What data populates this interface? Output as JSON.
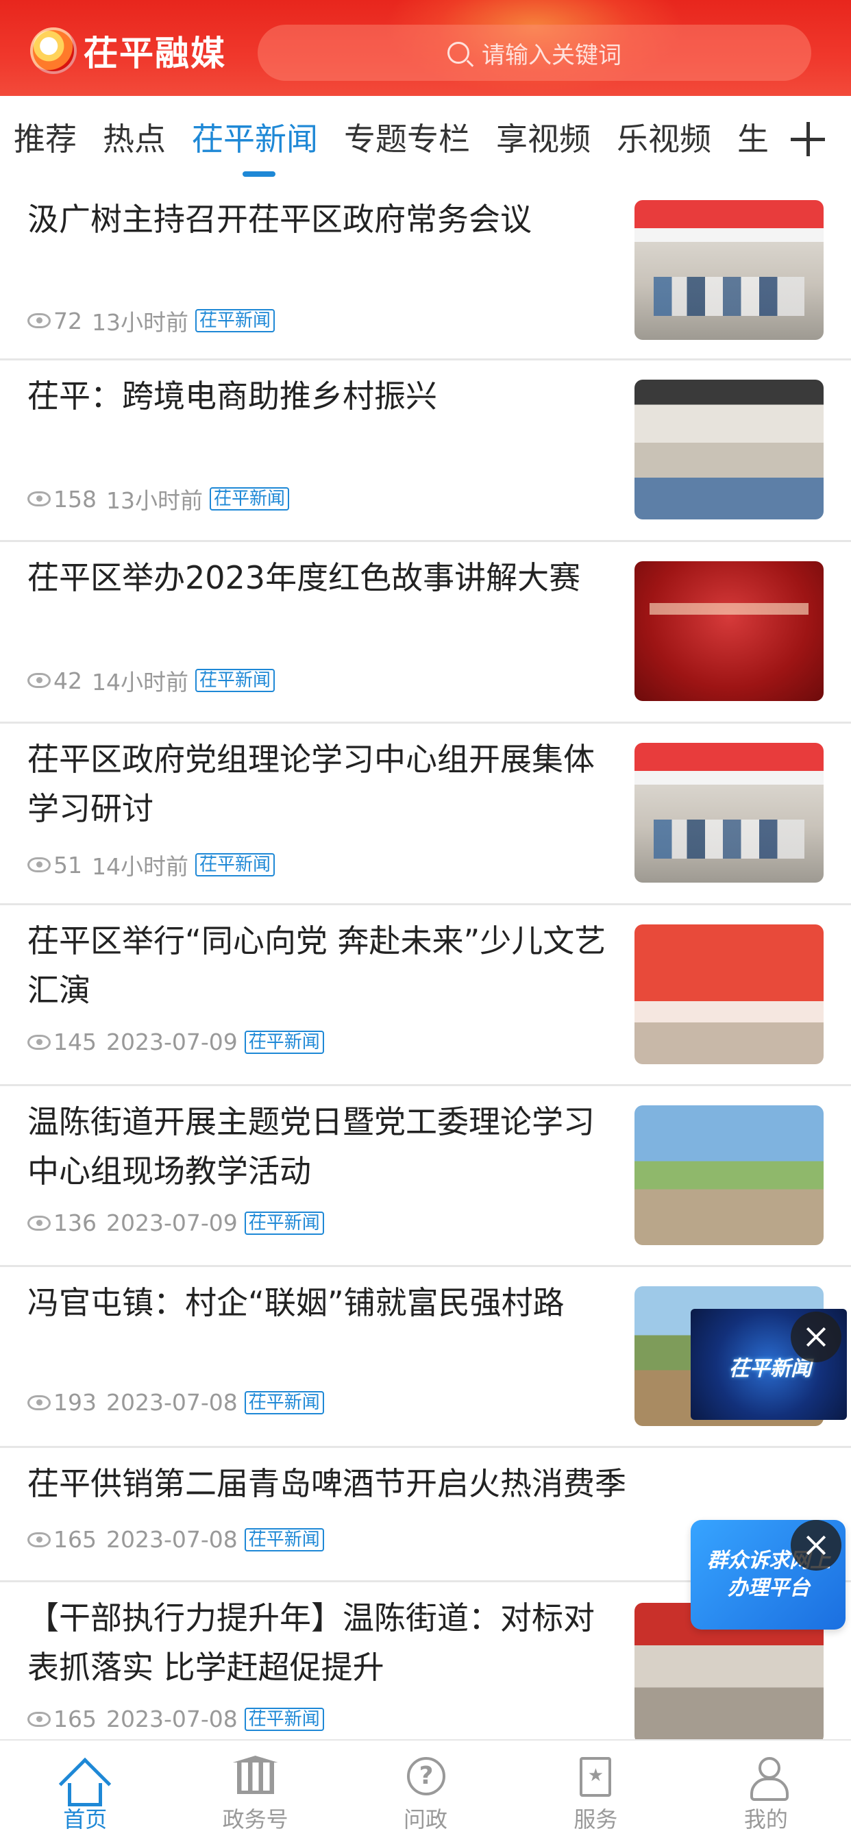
{
  "header": {
    "app_name": "茌平融媒",
    "search_placeholder": "请输入关键词"
  },
  "tabs": [
    {
      "label": "推荐"
    },
    {
      "label": "热点"
    },
    {
      "label": "茌平新闻",
      "active": true
    },
    {
      "label": "专题专栏"
    },
    {
      "label": "享视频"
    },
    {
      "label": "乐视频"
    },
    {
      "label": "生"
    }
  ],
  "news": [
    {
      "title": "汲广树主持召开茌平区政府常务会议",
      "views": "72",
      "time": "13小时前",
      "tag": "茌平新闻",
      "thumb": "meeting"
    },
    {
      "title": "茌平：跨境电商助推乡村振兴",
      "views": "158",
      "time": "13小时前",
      "tag": "茌平新闻",
      "thumb": "factory"
    },
    {
      "title": "茌平区举办2023年度红色故事讲解大赛",
      "views": "42",
      "time": "14小时前",
      "tag": "茌平新闻",
      "thumb": "red-stage"
    },
    {
      "title": "茌平区政府党组理论学习中心组开展集体学习研讨",
      "views": "51",
      "time": "14小时前",
      "tag": "茌平新闻",
      "thumb": "meeting"
    },
    {
      "title": "茌平区举行“同心向党  奔赴未来”少儿文艺汇演",
      "views": "145",
      "time": "2023-07-09",
      "tag": "茌平新闻",
      "thumb": "performance"
    },
    {
      "title": "温陈街道开展主题党日暨党工委理论学习中心组现场教学活动",
      "views": "136",
      "time": "2023-07-09",
      "tag": "茌平新闻",
      "thumb": "outdoor"
    },
    {
      "title": "冯官屯镇：村企“联姻”铺就富民强村路",
      "views": "193",
      "time": "2023-07-08",
      "tag": "茌平新闻",
      "thumb": "field"
    },
    {
      "title": "茌平供销第二届青岛啤酒节开启火热消费季",
      "views": "165",
      "time": "2023-07-08",
      "tag": "茌平新闻",
      "thumb": ""
    },
    {
      "title": "【干部执行力提升年】温陈街道：对标对表抓落实  比学赶超促提升",
      "views": "165",
      "time": "2023-07-08",
      "tag": "茌平新闻",
      "thumb": "plaza"
    }
  ],
  "floating": {
    "video_label": "茌平新闻",
    "service_label": "群众诉求网上办理平台"
  },
  "bottom_nav": [
    {
      "label": "首页",
      "icon": "home-icon",
      "active": true
    },
    {
      "label": "政务号",
      "icon": "government-building-icon"
    },
    {
      "label": "问政",
      "icon": "question-icon"
    },
    {
      "label": "服务",
      "icon": "star-bookmark-icon"
    },
    {
      "label": "我的",
      "icon": "user-icon"
    }
  ],
  "colors": {
    "header_red": "#e8261d",
    "accent_blue": "#1e88d6"
  }
}
